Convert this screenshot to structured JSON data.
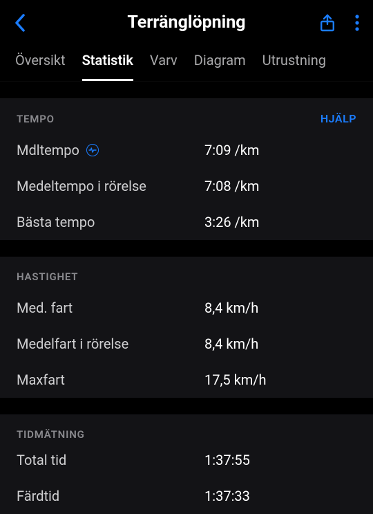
{
  "header": {
    "title": "Terränglöpning"
  },
  "tabs": [
    {
      "label": "Översikt",
      "active": false
    },
    {
      "label": "Statistik",
      "active": true
    },
    {
      "label": "Varv",
      "active": false
    },
    {
      "label": "Diagram",
      "active": false
    },
    {
      "label": "Utrustning",
      "active": false
    }
  ],
  "help_label": "HJÄLP",
  "sections": {
    "tempo": {
      "title": "TEMPO",
      "rows": [
        {
          "label": "Mdltempo",
          "value": "7:09 /km",
          "icon": true
        },
        {
          "label": "Medeltempo i rörelse",
          "value": "7:08 /km"
        },
        {
          "label": "Bästa tempo",
          "value": "3:26 /km"
        }
      ]
    },
    "hastighet": {
      "title": "HASTIGHET",
      "rows": [
        {
          "label": "Med. fart",
          "value": "8,4 km/h"
        },
        {
          "label": "Medelfart i rörelse",
          "value": "8,4 km/h"
        },
        {
          "label": "Maxfart",
          "value": "17,5 km/h"
        }
      ]
    },
    "tidmatning": {
      "title": "TIDMÄTNING",
      "rows": [
        {
          "label": "Total tid",
          "value": "1:37:55"
        },
        {
          "label": "Färdtid",
          "value": "1:37:33"
        }
      ]
    }
  }
}
